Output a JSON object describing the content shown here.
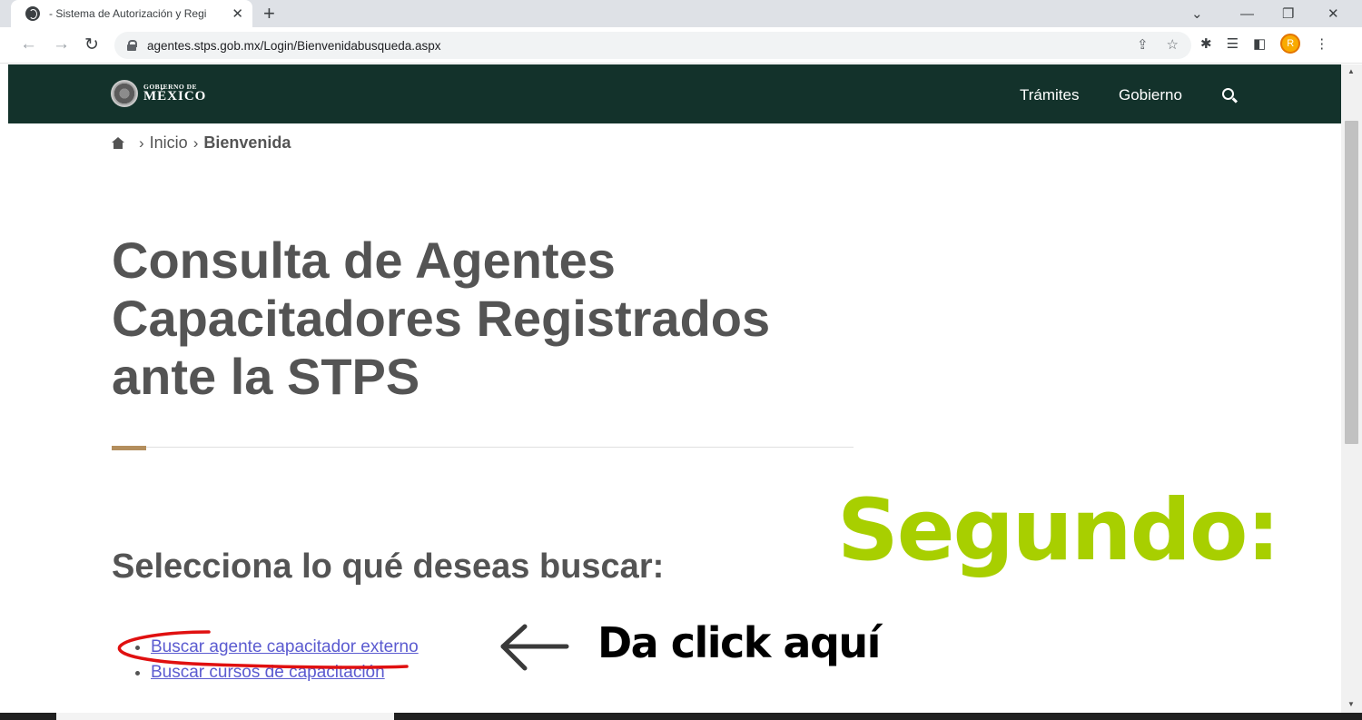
{
  "browser": {
    "tab_title": "- Sistema de Autorización y Regi",
    "url": "agentes.stps.gob.mx/Login/Bienvenidabusqueda.aspx",
    "avatar_letter": "R"
  },
  "header": {
    "logo_small": "GOBIERNO DE",
    "logo_big": "MÉXICO",
    "nav": [
      "Trámites",
      "Gobierno"
    ],
    "bg_color": "#13322b"
  },
  "breadcrumb": {
    "items": [
      "Inicio",
      "Bienvenida"
    ]
  },
  "main": {
    "title": "Consulta de Agentes Capacitadores Registrados ante la STPS",
    "subtitle": "Selecciona lo qué deseas buscar:",
    "links": [
      "Buscar agente capacitador externo",
      "Buscar cursos de capacitación"
    ],
    "accent_color": "#b38e5d"
  },
  "overlay": {
    "step": "Segundo:",
    "instruction": "Da click aquí",
    "step_color": "#a8cf00"
  }
}
